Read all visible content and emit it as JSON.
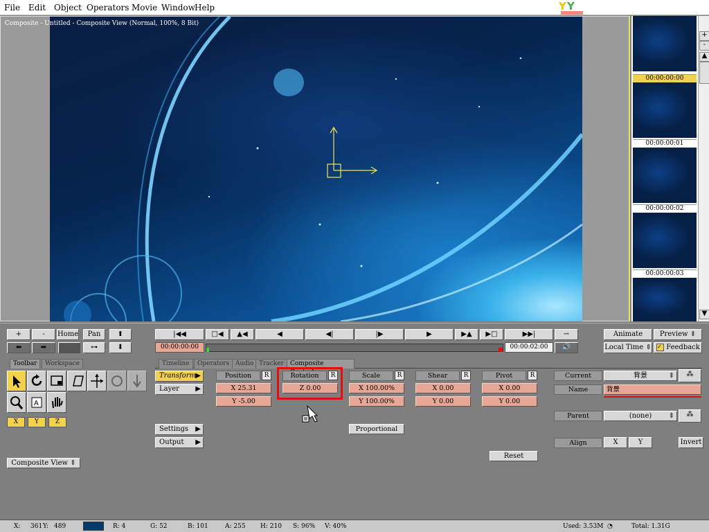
{
  "menu": [
    "File",
    "Edit",
    "Object",
    "Operators",
    "Movie",
    "Window",
    "Help"
  ],
  "viewer": {
    "title": "Composite - Untitled - Composite View (Normal, 100%, 8 Bit)"
  },
  "thumbs": [
    "00:00:00:00",
    "00:00:00:01",
    "00:00:00:02",
    "00:00:00:03"
  ],
  "scroll": {
    "plus": "+",
    "minus": "-"
  },
  "nav": {
    "plus": "+",
    "minus": "-",
    "home": "Home",
    "pan": "Pan"
  },
  "transport": {
    "current_time": "00:00:00:00",
    "end_time": "00:00:02:00",
    "progress": 0.0
  },
  "right_top": {
    "animate": "Animate",
    "preview": "Preview",
    "local_time": "Local Time",
    "feedback": "Feedback"
  },
  "tabs_left": [
    "Toolbar",
    "Workspace"
  ],
  "tabs_main": [
    "Timeline",
    "Operators",
    "Audio",
    "Tracker",
    "Composite Controls"
  ],
  "xyz": [
    "X",
    "Y",
    "Z"
  ],
  "view_select": "Composite View",
  "side_buttons": {
    "transform": "Transform",
    "layer": "Layer",
    "settings": "Settings",
    "output": "Output"
  },
  "groups": {
    "position": {
      "label": "Position",
      "r": "R",
      "v1": "X 25.31",
      "v2": "Y -5.00"
    },
    "rotation": {
      "label": "Rotation",
      "r": "R",
      "v1": "Z 0.00"
    },
    "scale": {
      "label": "Scale",
      "r": "R",
      "v1": "X 100.00%",
      "v2": "Y 100.00%"
    },
    "shear": {
      "label": "Shear",
      "r": "R",
      "v1": "X 0.00",
      "v2": "Y 0.00"
    },
    "pivot": {
      "label": "Pivot",
      "r": "R",
      "v1": "X 0.00",
      "v2": "Y 0.00"
    }
  },
  "proportional": "Proportional",
  "reset": "Reset",
  "object_props": {
    "current_label": "Current",
    "current_value": "背景",
    "name_label": "Name",
    "name_value": "背景",
    "parent_label": "Parent",
    "parent_value": "(none)",
    "align_label": "Align",
    "align_x": "X",
    "align_y": "Y",
    "invert": "Invert"
  },
  "status": {
    "x": "X:",
    "x_val": "361",
    "y": "Y:",
    "y_val": "489",
    "r": "R: 4",
    "g": "G: 52",
    "b": "B: 101",
    "a": "A: 255",
    "h": "H: 210",
    "s": "S: 96%",
    "v": "V: 40%",
    "used": "Used: 3.53M",
    "total": "Total: 1.31G"
  },
  "colors": {
    "accent": "#f1d24a",
    "peach": "#e6a796",
    "highlight": "#e01010",
    "swatch": "#063a6e"
  }
}
